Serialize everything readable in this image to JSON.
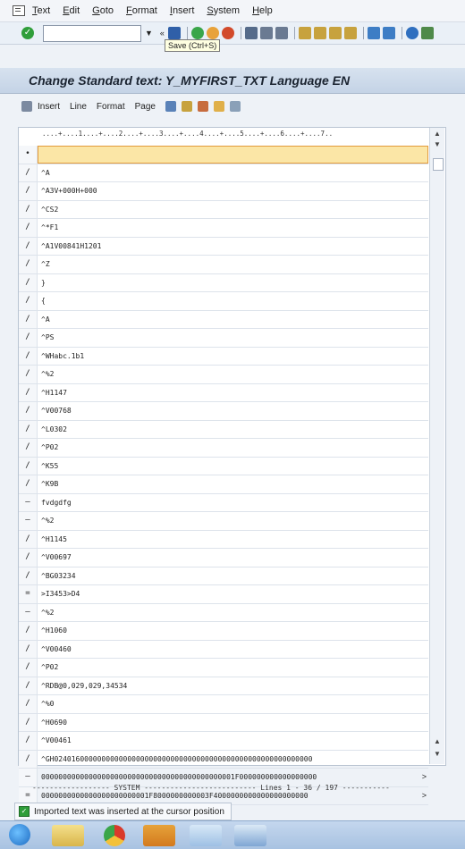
{
  "menu": {
    "items": [
      "Text",
      "Edit",
      "Goto",
      "Format",
      "Insert",
      "System",
      "Help"
    ]
  },
  "toolbar": {
    "command_field_value": "",
    "tooltip": "Save   (Ctrl+S)",
    "icons": [
      "enter-icon",
      "dropdown-icon",
      "back-icon",
      "save-icon",
      "back-green-icon",
      "exit-icon",
      "cancel-icon",
      "print-icon",
      "find-icon",
      "find-next-icon",
      "first-page-icon",
      "prev-page-icon",
      "next-page-icon",
      "last-page-icon",
      "new-session-icon",
      "shortcut-icon",
      "help-icon",
      "layout-icon"
    ]
  },
  "title": "Change Standard text: Y_MYFIRST_TXT Language EN",
  "app_toolbar": {
    "items": [
      "Insert",
      "Line",
      "Format",
      "Page"
    ]
  },
  "editor": {
    "ruler": "....+....1....+....2....+....3....+....4....+....5....+....6....+....7..",
    "rows": [
      {
        "fmt": "•",
        "text": "",
        "more": ""
      },
      {
        "fmt": "/",
        "text": "^A",
        "more": ""
      },
      {
        "fmt": "/",
        "text": "^A3V+000H+000",
        "more": ""
      },
      {
        "fmt": "/",
        "text": "^CS2",
        "more": ""
      },
      {
        "fmt": "/",
        "text": "^*F1",
        "more": ""
      },
      {
        "fmt": "/",
        "text": "^A1V00841H1201",
        "more": ""
      },
      {
        "fmt": "/",
        "text": "^Z",
        "more": ""
      },
      {
        "fmt": "/",
        "text": "}",
        "more": ""
      },
      {
        "fmt": "/",
        "text": "{",
        "more": ""
      },
      {
        "fmt": "/",
        "text": "^A",
        "more": ""
      },
      {
        "fmt": "/",
        "text": "^PS",
        "more": ""
      },
      {
        "fmt": "/",
        "text": "^WHabc.1b1",
        "more": ""
      },
      {
        "fmt": "/",
        "text": "^%2",
        "more": ""
      },
      {
        "fmt": "/",
        "text": "^H1147",
        "more": ""
      },
      {
        "fmt": "/",
        "text": "^V00768",
        "more": ""
      },
      {
        "fmt": "/",
        "text": "^L0302",
        "more": ""
      },
      {
        "fmt": "/",
        "text": "^P02",
        "more": ""
      },
      {
        "fmt": "/",
        "text": "^K55",
        "more": ""
      },
      {
        "fmt": "/",
        "text": "^K9B",
        "more": ""
      },
      {
        "fmt": "–",
        "text": "fvdgdfg",
        "more": ""
      },
      {
        "fmt": "–",
        "text": "^%2",
        "more": ""
      },
      {
        "fmt": "/",
        "text": "^H1145",
        "more": ""
      },
      {
        "fmt": "/",
        "text": "^V00697",
        "more": ""
      },
      {
        "fmt": "/",
        "text": "^BG03234",
        "more": ""
      },
      {
        "fmt": "=",
        "text": ">I3453>D4",
        "more": ""
      },
      {
        "fmt": "–",
        "text": "^%2",
        "more": ""
      },
      {
        "fmt": "/",
        "text": "^H1060",
        "more": ""
      },
      {
        "fmt": "/",
        "text": "^V00460",
        "more": ""
      },
      {
        "fmt": "/",
        "text": "^P02",
        "more": ""
      },
      {
        "fmt": "/",
        "text": "^RDB@0,029,029,34534",
        "more": ""
      },
      {
        "fmt": "/",
        "text": "^%0",
        "more": ""
      },
      {
        "fmt": "/",
        "text": "^H0690",
        "more": ""
      },
      {
        "fmt": "/",
        "text": "^V00461",
        "more": ""
      },
      {
        "fmt": "/",
        "text": "^GH024016000000000000000000000000000000000000000000000000000000",
        "more": ""
      },
      {
        "fmt": "–",
        "text": "000000000000000000000000000000000000000000001F000000000000000000",
        "more": ">"
      },
      {
        "fmt": "=",
        "text": "0000000000000000000000001F8000000000003F4000000000000000000000",
        "more": ">"
      }
    ]
  },
  "status_line": "------------------ SYSTEM -------------------------- Lines 1 - 36 / 197 -----------",
  "message": "Imported text was inserted at the cursor position"
}
